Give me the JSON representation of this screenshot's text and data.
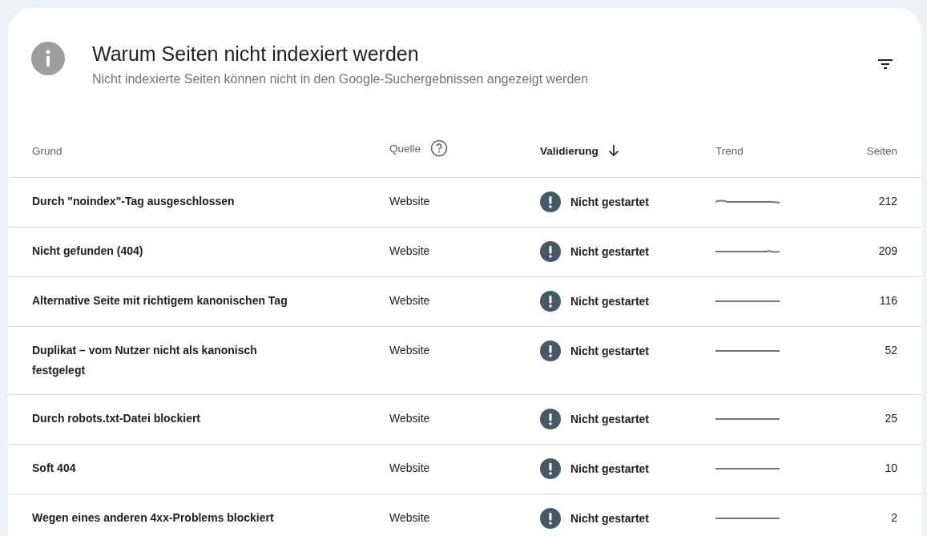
{
  "header": {
    "title": "Warum Seiten nicht indexiert werden",
    "subtitle": "Nicht indexierte Seiten können nicht in den Google-Suchergebnissen angezeigt werden"
  },
  "table": {
    "columns": [
      {
        "label": "Grund",
        "kind": "text",
        "sorted": false
      },
      {
        "label": "Quelle",
        "kind": "help",
        "sorted": false
      },
      {
        "label": "Validierung",
        "kind": "text",
        "sorted": true
      },
      {
        "label": "Trend",
        "kind": "text",
        "sorted": false
      },
      {
        "label": "Seiten",
        "kind": "number",
        "sorted": false
      }
    ],
    "rows": [
      {
        "reason": "Durch \"noindex\"-Tag ausgeschlossen",
        "source": "Website",
        "validation": "Nicht gestartet",
        "pages": "212"
      },
      {
        "reason": "Nicht gefunden (404)",
        "source": "Website",
        "validation": "Nicht gestartet",
        "pages": "209"
      },
      {
        "reason": "Alternative Seite mit richtigem kanonischen Tag",
        "source": "Website",
        "validation": "Nicht gestartet",
        "pages": "116"
      },
      {
        "reason": "Duplikat – vom Nutzer nicht als kanonisch festgelegt",
        "source": "Website",
        "validation": "Nicht gestartet",
        "pages": "52"
      },
      {
        "reason": "Durch robots.txt-Datei blockiert",
        "source": "Website",
        "validation": "Nicht gestartet",
        "pages": "25"
      },
      {
        "reason": "Soft 404",
        "source": "Website",
        "validation": "Nicht gestartet",
        "pages": "10"
      },
      {
        "reason": "Wegen eines anderen 4xx-Problems blockiert",
        "source": "Website",
        "validation": "Nicht gestartet",
        "pages": "2"
      }
    ]
  }
}
